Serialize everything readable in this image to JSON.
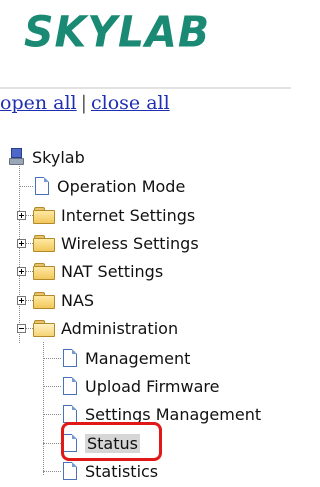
{
  "logo": {
    "text": "SKYLAB"
  },
  "top_links": {
    "open_all": "open all",
    "separator": "|",
    "close_all": "close all"
  },
  "tree": {
    "root": "Skylab",
    "items": [
      {
        "label": "Operation Mode"
      },
      {
        "label": "Internet Settings"
      },
      {
        "label": "Wireless Settings"
      },
      {
        "label": "NAT Settings"
      },
      {
        "label": "NAS"
      },
      {
        "label": "Administration"
      }
    ],
    "admin_children": [
      {
        "label": "Management"
      },
      {
        "label": "Upload Firmware"
      },
      {
        "label": "Settings Management"
      },
      {
        "label": "Status",
        "selected": true
      },
      {
        "label": "Statistics"
      }
    ]
  },
  "colors": {
    "logo": "#1a8a74",
    "link": "#1f2fb0",
    "highlight": "#e01818",
    "selected_bg": "#d6d6d6"
  }
}
